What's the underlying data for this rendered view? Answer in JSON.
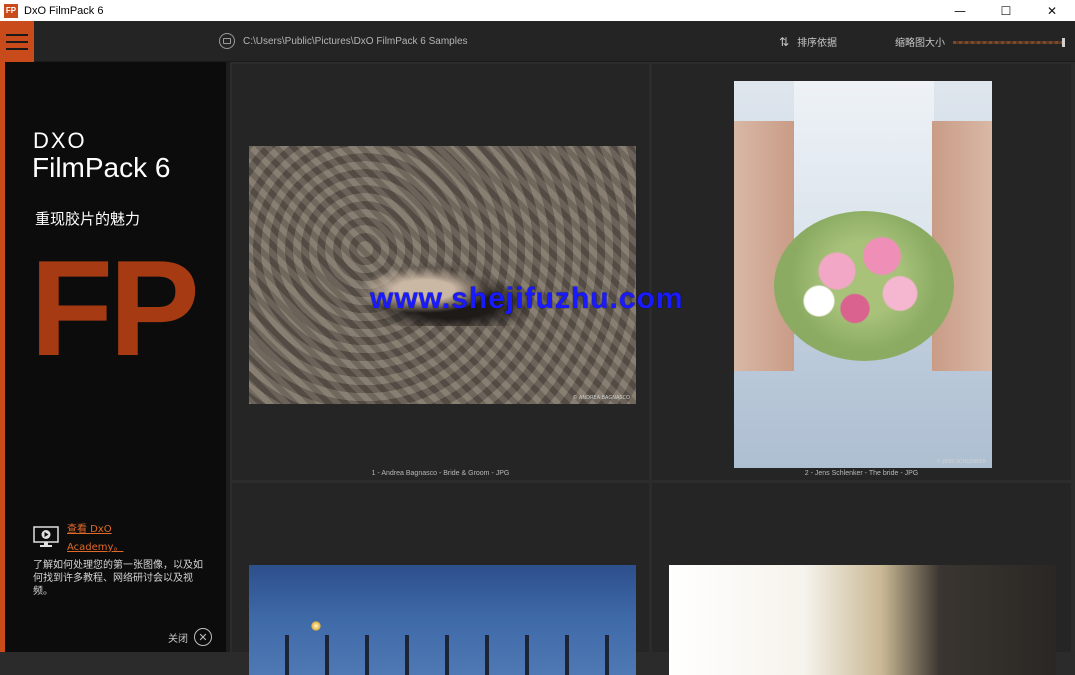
{
  "window": {
    "app_icon_text": "FP",
    "title": "DxO FilmPack 6",
    "minimize_glyph": "—",
    "maximize_glyph": "☐",
    "close_glyph": "✕"
  },
  "toolbar": {
    "path": "C:\\Users\\Public\\Pictures\\DxO FilmPack 6 Samples",
    "sort_label": "排序依据",
    "sort_icon": "⇅",
    "thumb_size_label": "缩略图大小",
    "thumb_size_level": 1.0
  },
  "sidebar": {
    "brand": "DXO",
    "product": "FilmPack 6",
    "tagline": "重现胶片的魅力",
    "logo_letters": "FP",
    "academy_link": "查看 DxO Academy。",
    "academy_desc": "了解如何处理您的第一张图像，以及如何找到许多教程、网络研讨会以及视频。",
    "close_label": "关闭",
    "close_glyph": "✕"
  },
  "gallery": {
    "items": [
      {
        "caption": "1 - Andrea Bagnasco - Bride & Groom - JPG",
        "credit": "© ANDREA BAGNASCO"
      },
      {
        "caption": "2 - Jens Schlenker - The bride - JPG",
        "credit": "© JENS SCHLENKER"
      },
      {
        "caption": ""
      },
      {
        "caption": ""
      }
    ]
  },
  "watermark": "www.shejifuzhu.com",
  "colors": {
    "accent": "#c94a1a",
    "fp_logo": "#a63a12",
    "link": "#e06a2a"
  }
}
